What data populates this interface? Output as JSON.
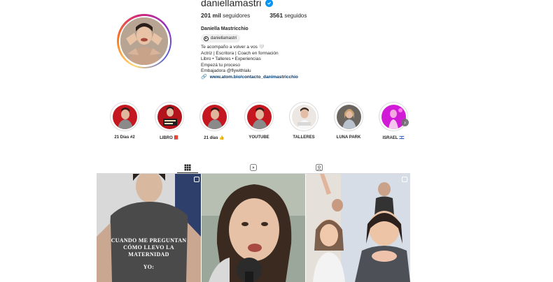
{
  "profile": {
    "username": "daniellamastri",
    "verified_icon": "verified-badge-icon",
    "followers_count": "201 mil",
    "followers_label": "seguidores",
    "following_count": "3561",
    "following_label": "seguidos",
    "full_name": "Daniella Mastricchio",
    "threads_handle": "daniellamastri",
    "bio_lines": [
      "Te acompaño a volver a vos 🤍",
      "Actriz | Escritora | Coach en formación",
      "Libro • Talleres • Experiencias",
      "Empezá tu proceso",
      "Embajadora @flywithlalu"
    ],
    "link": "www.atom.bio/contacto_danimastricchio"
  },
  "highlights": [
    {
      "label": "21 Días #2"
    },
    {
      "label": "LIBRO 📕"
    },
    {
      "label": "21 días 👍"
    },
    {
      "label": "YOUTUBE"
    },
    {
      "label": "TALLERES"
    },
    {
      "label": "LUNA PARK"
    },
    {
      "label": "ISRAEL 🇮🇱"
    }
  ],
  "tabs": [
    {
      "name": "posts",
      "icon": "grid-icon",
      "active": true
    },
    {
      "name": "reels",
      "icon": "reels-icon",
      "active": false
    },
    {
      "name": "tagged",
      "icon": "tagged-icon",
      "active": false
    }
  ],
  "posts": [
    {
      "overlay_lines": [
        "CUANDO ME PREGUNTAN",
        "CÓMO LLEVO LA",
        "MATERNIDAD"
      ],
      "overlay_yo": "YO:"
    },
    {
      "overlay_lines": []
    },
    {
      "overlay_lines": []
    }
  ],
  "colors": {
    "accent_blue": "#0095f6",
    "link": "#00376b",
    "text": "#262626",
    "border": "#dbdbdb"
  }
}
